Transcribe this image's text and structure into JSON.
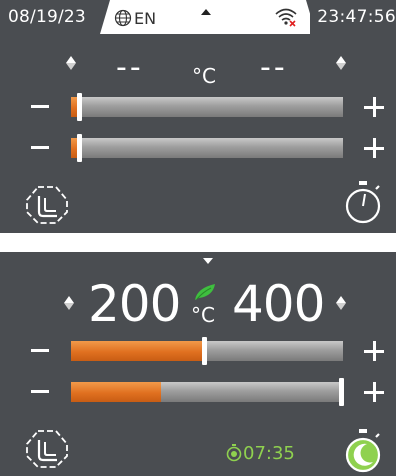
{
  "status_bar": {
    "date": "08/19/23",
    "language": "EN",
    "time": "23:47:56"
  },
  "top_panel": {
    "left_temp": "--",
    "unit": "°C",
    "right_temp": "--",
    "slider_1_level": 0.03,
    "slider_2_level": 0.03
  },
  "bottom_panel": {
    "left_temp": "200",
    "unit": "°C",
    "right_temp": "400",
    "slider_1_level": 0.49,
    "slider_2_level": 1.0,
    "slider_2_orange_fill": 0.33,
    "timer": "07:35"
  },
  "colors": {
    "panel_bg": "#4a4d51",
    "accent_orange": "#e07020",
    "timer_green": "#8fd14f",
    "leaf_green": "#3fbf3f"
  },
  "icons": [
    "globe-icon",
    "wifi-off-icon",
    "up-caret-icon",
    "down-caret-icon",
    "mode-icon",
    "stopwatch-icon",
    "leaf-icon",
    "moon-stopwatch-icon"
  ]
}
